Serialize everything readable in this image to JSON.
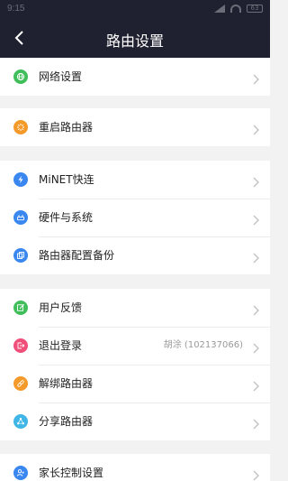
{
  "status_bar": {
    "time": "9:15",
    "battery": "63"
  },
  "nav": {
    "title": "路由设置"
  },
  "colors": {
    "header_bg": "#1f2130",
    "page_bg": "#f2f2f2",
    "green": "#3fbe5a",
    "orange": "#f39a2a",
    "blue": "#3a87f0",
    "pink": "#f04f7a",
    "cyan": "#40b6e6"
  },
  "groups": [
    {
      "items": [
        {
          "label": "网络设置",
          "icon": "globe-icon"
        }
      ]
    },
    {
      "items": [
        {
          "label": "重启路由器",
          "icon": "restart-icon"
        }
      ]
    },
    {
      "items": [
        {
          "label": "MiNET快连",
          "icon": "lightning-icon"
        },
        {
          "label": "硬件与系统",
          "icon": "router-icon"
        },
        {
          "label": "路由器配置备份",
          "icon": "backup-icon"
        }
      ]
    },
    {
      "items": [
        {
          "label": "用户反馈",
          "icon": "edit-icon"
        },
        {
          "label": "退出登录",
          "icon": "logout-icon",
          "value": "胡涂 (102137066)"
        },
        {
          "label": "解绑路由器",
          "icon": "unbind-icon"
        },
        {
          "label": "分享路由器",
          "icon": "share-icon"
        }
      ]
    },
    {
      "items": [
        {
          "label": "家长控制设置",
          "icon": "parental-control-icon"
        }
      ]
    }
  ]
}
